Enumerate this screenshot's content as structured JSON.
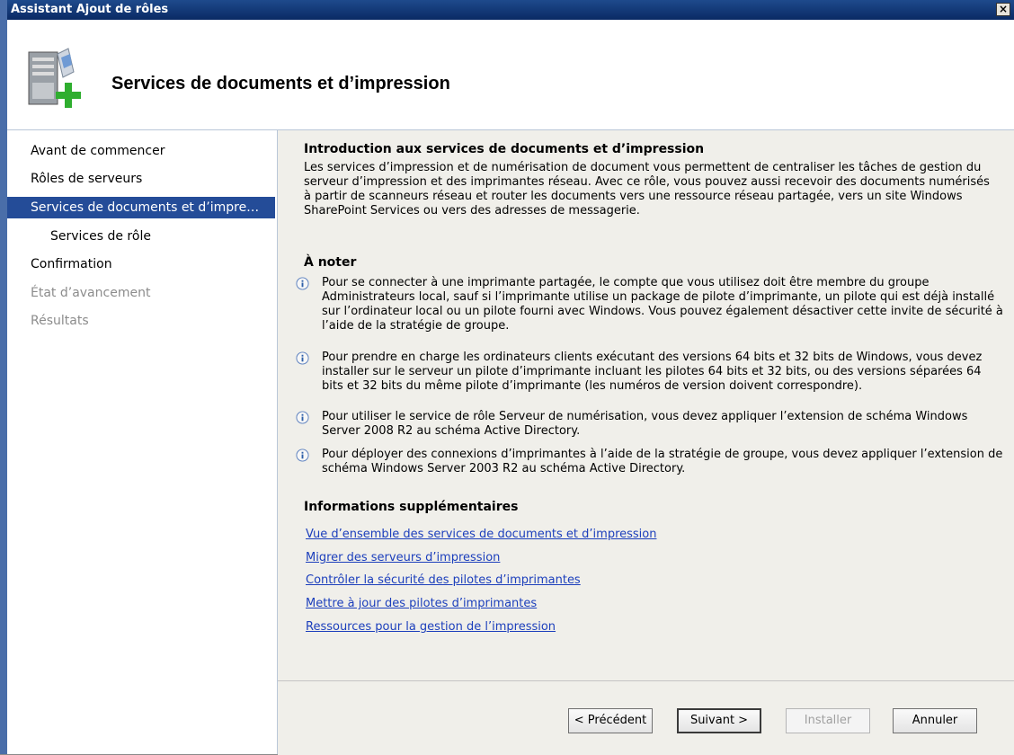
{
  "window": {
    "title": "Assistant Ajout de rôles",
    "close_label": "×"
  },
  "header": {
    "heading": "Services de documents et d’impression"
  },
  "nav": {
    "items": [
      {
        "label": "Avant de commencer"
      },
      {
        "label": "Rôles de serveurs"
      },
      {
        "label": "Services de documents et d’impre…"
      },
      {
        "label": "Services de rôle"
      },
      {
        "label": "Confirmation"
      },
      {
        "label": "État d’avancement"
      },
      {
        "label": "Résultats"
      }
    ]
  },
  "content": {
    "intro_title": "Introduction aux services de documents et d’impression",
    "intro_text": "Les services d’impression et de numérisation de document vous permettent de centraliser les tâches de gestion du serveur d’impression et des imprimantes réseau. Avec ce rôle, vous pouvez aussi recevoir des documents numérisés à partir de scanneurs réseau et router les documents vers une ressource réseau partagée, vers un site Windows SharePoint Services ou vers des adresses de messagerie.",
    "notes_title": "À noter",
    "notes": [
      "Pour se connecter à une imprimante partagée, le compte que vous utilisez doit être membre du groupe Administrateurs local, sauf si l’imprimante utilise un package de pilote d’imprimante, un pilote qui est déjà installé sur l’ordinateur local ou un pilote fourni avec Windows. Vous pouvez également désactiver cette invite de sécurité à l’aide de la stratégie de groupe.",
      "Pour prendre en charge les ordinateurs clients exécutant des versions 64 bits et 32 bits de Windows, vous devez installer sur le serveur un pilote d’imprimante incluant les pilotes 64 bits et 32 bits, ou des versions séparées 64 bits et 32 bits du même pilote d’imprimante (les numéros de version doivent correspondre).",
      "Pour utiliser le service de rôle Serveur de numérisation, vous devez appliquer l’extension de schéma Windows Server 2008 R2 au schéma Active Directory.",
      "Pour déployer des connexions d’imprimantes à l’aide de la stratégie de groupe, vous devez appliquer l’extension de schéma Windows Server 2003 R2 au schéma Active Directory."
    ],
    "more_title": "Informations supplémentaires",
    "links": [
      "Vue d’ensemble des services de documents et d’impression",
      "Migrer des serveurs d’impression",
      "Contrôler la sécurité des pilotes d’imprimantes",
      "Mettre à jour des pilotes d’imprimantes",
      "Ressources pour la gestion de l’impression"
    ]
  },
  "footer": {
    "previous": "< Précédent",
    "next": "Suivant >",
    "install": "Installer",
    "cancel": "Annuler"
  },
  "colors": {
    "accent": "#244c98",
    "link": "#1c3fbc"
  }
}
